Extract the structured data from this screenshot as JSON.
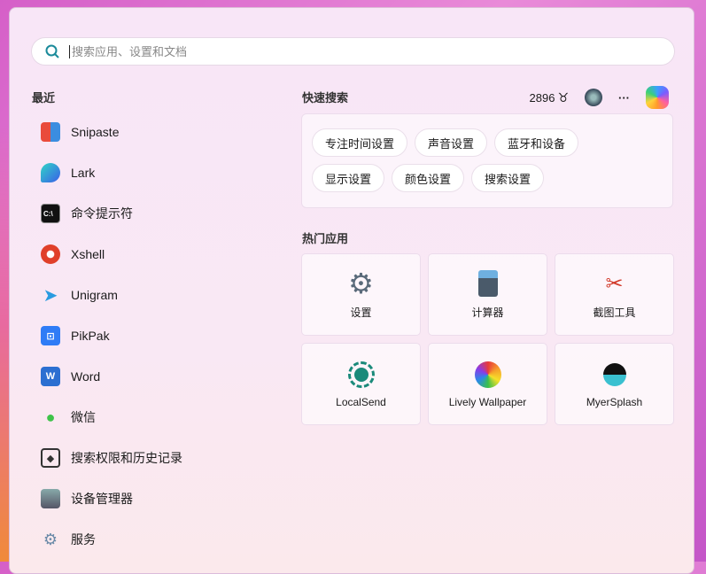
{
  "search": {
    "placeholder": "搜索应用、设置和文档"
  },
  "recent": {
    "title": "最近",
    "items": [
      {
        "label": "Snipaste",
        "icon": "snipaste-icon"
      },
      {
        "label": "Lark",
        "icon": "lark-icon"
      },
      {
        "label": "命令提示符",
        "icon": "cmd-icon"
      },
      {
        "label": "Xshell",
        "icon": "xshell-icon"
      },
      {
        "label": "Unigram",
        "icon": "unigram-icon"
      },
      {
        "label": "PikPak",
        "icon": "pikpak-icon"
      },
      {
        "label": "Word",
        "icon": "word-icon"
      },
      {
        "label": "微信",
        "icon": "wechat-icon"
      },
      {
        "label": "搜索权限和历史记录",
        "icon": "search-permissions-icon"
      },
      {
        "label": "设备管理器",
        "icon": "device-manager-icon"
      },
      {
        "label": "服务",
        "icon": "services-icon"
      }
    ]
  },
  "header": {
    "points": "2896",
    "more": "···"
  },
  "quick": {
    "title": "快速搜索",
    "chips": [
      "专注时间设置",
      "声音设置",
      "蓝牙和设备",
      "显示设置",
      "颜色设置",
      "搜索设置"
    ]
  },
  "hot": {
    "title": "热门应用",
    "apps": [
      {
        "label": "设置"
      },
      {
        "label": "计算器"
      },
      {
        "label": "截图工具"
      },
      {
        "label": "LocalSend"
      },
      {
        "label": "Lively Wallpaper"
      },
      {
        "label": "MyerSplash"
      }
    ]
  }
}
